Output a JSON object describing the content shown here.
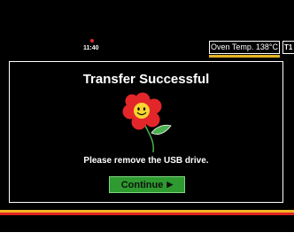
{
  "status_bar": {
    "time": "11:40",
    "oven_temp": "Oven Temp. 138°C",
    "mode": "T1"
  },
  "dialog": {
    "title": "Transfer Successful",
    "message": "Please remove the USB drive.",
    "continue_label": "Continue",
    "continue_arrow": "▶"
  },
  "colors": {
    "background": "#000000",
    "button": "#2e9a2f",
    "flower_petals": "#e3262a",
    "flower_center": "#f7d531",
    "accent_yellow": "#f2b526",
    "accent_red": "#de2421"
  },
  "icons": [
    "flower-icon",
    "play-arrow-icon"
  ]
}
